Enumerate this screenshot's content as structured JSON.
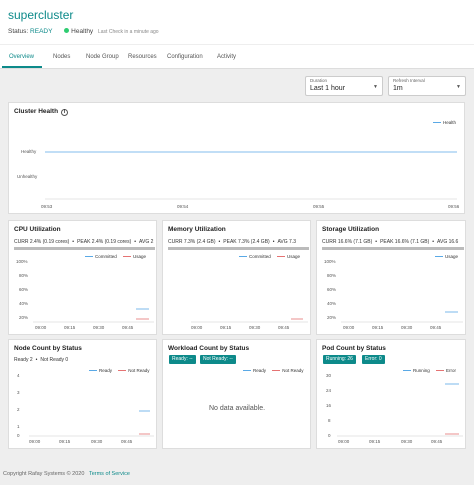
{
  "header": {
    "title": "supercluster",
    "status_label": "Status:",
    "status_value": "READY",
    "health": "Healthy",
    "last_check": "Last Check in a minute ago"
  },
  "tabs": [
    "Overview",
    "Nodes",
    "Node Group",
    "Resources",
    "Configuration",
    "Activity"
  ],
  "filters": {
    "duration": {
      "label": "Duration",
      "value": "Last 1 hour"
    },
    "refresh": {
      "label": "Refresh Interval",
      "value": "1m"
    }
  },
  "cluster_health": {
    "title": "Cluster Health",
    "legend": "Health",
    "y_labels": [
      "Healthy",
      "Unhealthy"
    ],
    "x_labels": [
      "09:53",
      "09:54",
      "09:55",
      "09:56"
    ]
  },
  "cpu": {
    "title": "CPU Utilization",
    "curr": "CURR 2.4% (0.19 cores)",
    "peak": "PEAK 2.4% (0.19 cores)",
    "avg": "AVG 2",
    "legend": [
      "Committed",
      "Usage"
    ],
    "y_labels": [
      "100%",
      "80%",
      "60%",
      "40%",
      "20%",
      "0%"
    ],
    "x_labels": [
      "09:00",
      "09:15",
      "09:30",
      "09:45"
    ]
  },
  "memory": {
    "title": "Memory Utilization",
    "curr": "CURR 7.3% (2.4 GB)",
    "peak": "PEAK 7.3% (2.4 GB)",
    "avg": "AVG 7.3",
    "legend": [
      "Committed",
      "Usage"
    ],
    "x_labels": [
      "09:00",
      "09:15",
      "09:30",
      "09:45"
    ]
  },
  "storage": {
    "title": "Storage Utilization",
    "curr": "CURR 16.6% (7.1 GB)",
    "peak": "PEAK 16.6% (7.1 GB)",
    "avg": "AVG 16.6",
    "legend": [
      "Usage"
    ],
    "y_labels": [
      "100%",
      "80%",
      "60%",
      "40%",
      "20%",
      "0%"
    ],
    "x_labels": [
      "09:00",
      "09:15",
      "09:30",
      "09:45"
    ]
  },
  "node_count": {
    "title": "Node Count by Status",
    "ready": "Ready 2",
    "not_ready": "Not Ready 0",
    "legend": [
      "Ready",
      "Not Ready"
    ],
    "y_labels": [
      "4",
      "3",
      "2",
      "1",
      "0"
    ],
    "x_labels": [
      "09:00",
      "09:15",
      "09:30",
      "09:45"
    ]
  },
  "workload_count": {
    "title": "Workload Count by Status",
    "ready_btn": "Ready: --",
    "not_ready_btn": "Not Ready: --",
    "legend": [
      "Ready",
      "Not Ready"
    ],
    "no_data": "No data available."
  },
  "pod_count": {
    "title": "Pod Count by Status",
    "running_btn": "Running: 26",
    "error_btn": "Error: 0",
    "legend": [
      "Running",
      "Error"
    ],
    "y_labels": [
      "30",
      "24",
      "16",
      "8",
      "0"
    ],
    "x_labels": [
      "09:00",
      "09:15",
      "09:30",
      "09:45"
    ]
  },
  "footer": {
    "copyright": "Copyright Rafay Systems © 2020",
    "terms": "Terms of Service"
  },
  "colors": {
    "accent": "#0d8a8a",
    "line_blue": "#5aa9e6",
    "line_red": "#e57373",
    "healthy_dot": "#2ecc71"
  }
}
